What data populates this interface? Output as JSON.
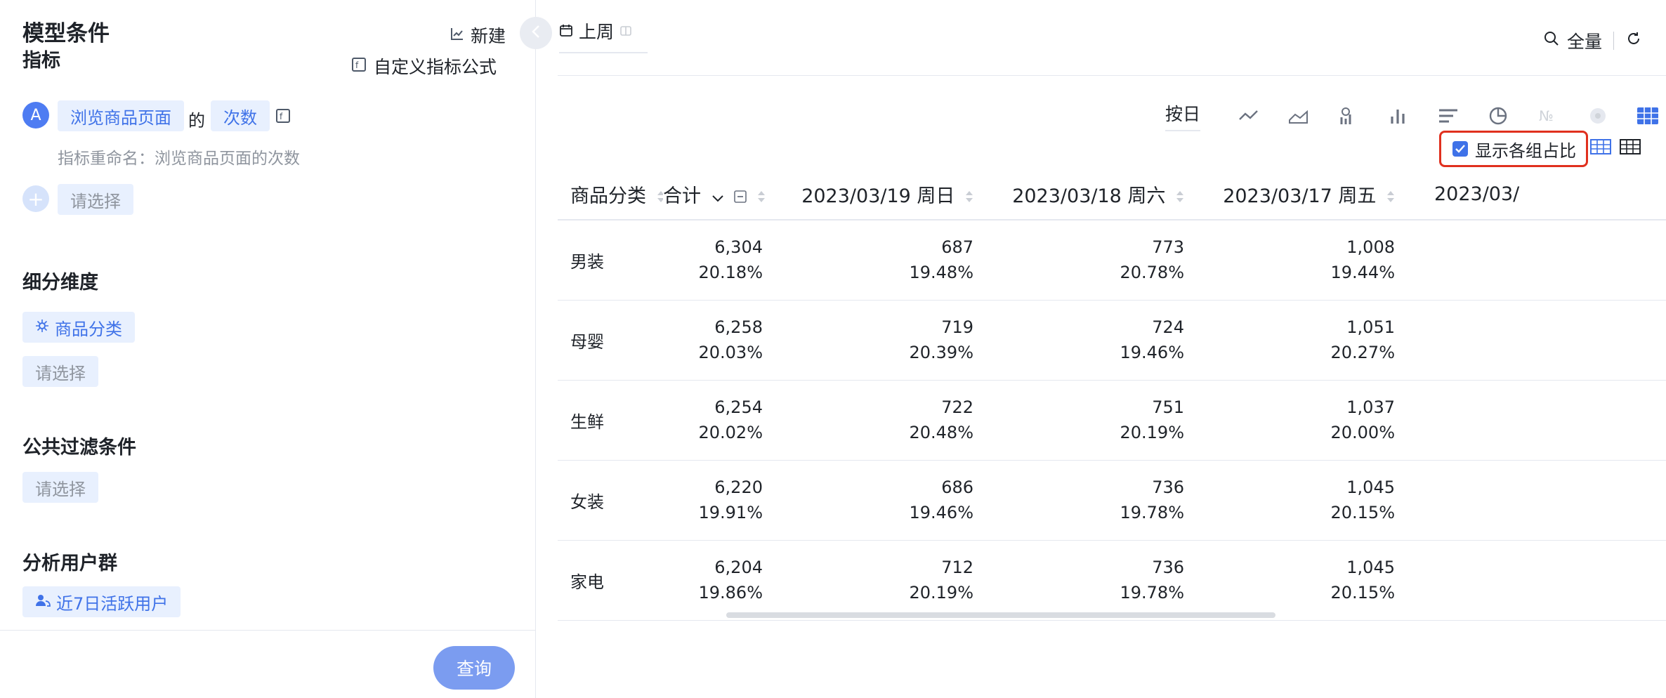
{
  "left_panel": {
    "title": "模型条件",
    "new_label": "新建",
    "metrics_label": "指标",
    "custom_formula_label": "自定义指标公式",
    "metric": {
      "badge": "A",
      "event": "浏览商品页面",
      "connector": "的",
      "measure": "次数",
      "rename_label": "指标重命名：浏览商品页面的次数"
    },
    "add_metric_placeholder": "请选择",
    "breakdown_label": "细分维度",
    "breakdown_chip": "商品分类",
    "breakdown_placeholder": "请选择",
    "filter_label": "公共过滤条件",
    "filter_placeholder": "请选择",
    "segment_label": "分析用户群",
    "segment_chip": "近7日活跃用户",
    "query_button": "查询"
  },
  "right_panel": {
    "date_tab": "上周",
    "search_scope": "全量",
    "granularity": "按日",
    "show_ratio_label": "显示各组占比",
    "show_ratio_checked": true,
    "accent": "#3f72e8",
    "highlight_color": "#e0301e",
    "table": {
      "headers": [
        "商品分类",
        "合计",
        "2023/03/19 周日",
        "2023/03/18 周六",
        "2023/03/17 周五",
        "2023/03/"
      ],
      "rows": [
        {
          "cat": "男装",
          "cells": [
            [
              "6,304",
              "20.18%"
            ],
            [
              "687",
              "19.48%"
            ],
            [
              "773",
              "20.78%"
            ],
            [
              "1,008",
              "19.44%"
            ]
          ]
        },
        {
          "cat": "母婴",
          "cells": [
            [
              "6,258",
              "20.03%"
            ],
            [
              "719",
              "20.39%"
            ],
            [
              "724",
              "19.46%"
            ],
            [
              "1,051",
              "20.27%"
            ]
          ]
        },
        {
          "cat": "生鲜",
          "cells": [
            [
              "6,254",
              "20.02%"
            ],
            [
              "722",
              "20.48%"
            ],
            [
              "751",
              "20.19%"
            ],
            [
              "1,037",
              "20.00%"
            ]
          ]
        },
        {
          "cat": "女装",
          "cells": [
            [
              "6,220",
              "19.91%"
            ],
            [
              "686",
              "19.46%"
            ],
            [
              "736",
              "19.78%"
            ],
            [
              "1,045",
              "20.15%"
            ]
          ]
        },
        {
          "cat": "家电",
          "cells": [
            [
              "6,204",
              "19.86%"
            ],
            [
              "712",
              "20.19%"
            ],
            [
              "736",
              "19.78%"
            ],
            [
              "1,045",
              "20.15%"
            ]
          ]
        }
      ]
    }
  }
}
